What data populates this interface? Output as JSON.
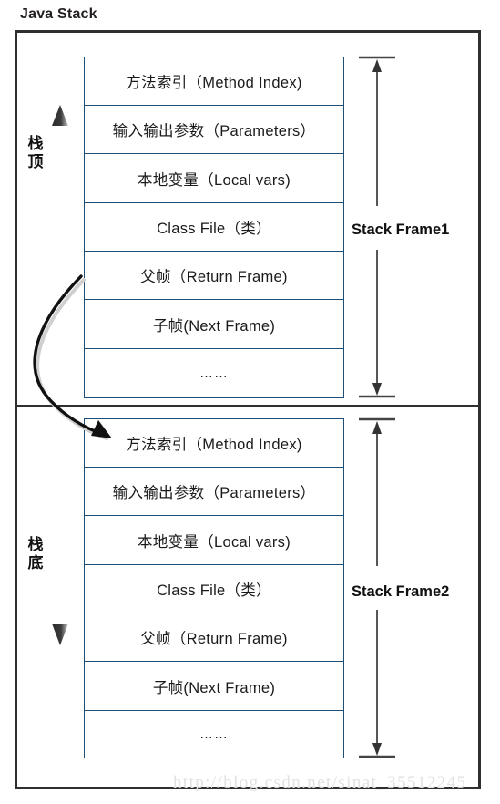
{
  "title": "Java Stack",
  "colors": {
    "outer_border": "#2f2f2f",
    "row_border": "#1f4e79",
    "text": "#1a1a1a",
    "watermark": "#e2e2e2"
  },
  "frames": [
    {
      "id": "stack-frame-1",
      "dimension_label": "Stack Frame1",
      "direction_label": "栈顶",
      "direction": "up",
      "rows": [
        {
          "label": "方法索引（Method Index)"
        },
        {
          "label": "输入输出参数（Parameters）"
        },
        {
          "label": "本地变量（Local vars)"
        },
        {
          "label": "Class File（类）"
        },
        {
          "label": "父帧（Return Frame)"
        },
        {
          "label": "子帧(Next Frame)"
        },
        {
          "label": "……"
        }
      ]
    },
    {
      "id": "stack-frame-2",
      "dimension_label": "Stack Frame2",
      "direction_label": "栈底",
      "direction": "down",
      "rows": [
        {
          "label": "方法索引（Method Index)"
        },
        {
          "label": "输入输出参数（Parameters）"
        },
        {
          "label": "本地变量（Local vars)"
        },
        {
          "label": "Class File（类）"
        },
        {
          "label": "父帧（Return Frame)"
        },
        {
          "label": "子帧(Next Frame)"
        },
        {
          "label": "……"
        }
      ]
    }
  ],
  "link_arrow": {
    "from_row": "父帧（Return Frame)",
    "to_row": "方法索引（Method Index)"
  },
  "watermark": "http://blog.csdn.net/sinat_35512245"
}
